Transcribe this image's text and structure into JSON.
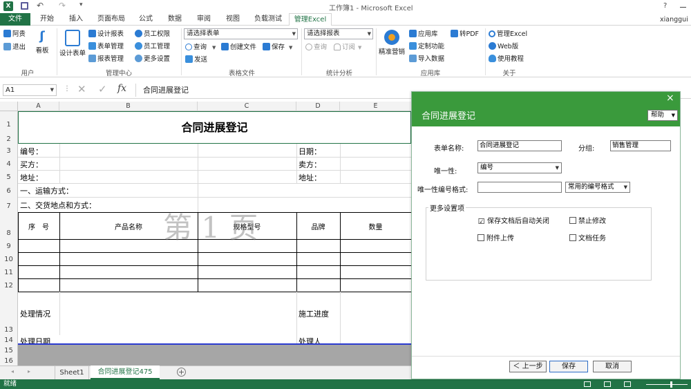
{
  "window": {
    "title": "工作簿1 - Microsoft Excel",
    "user": "xianggui",
    "help": "?"
  },
  "tabs": [
    "文件",
    "开始",
    "插入",
    "页面布局",
    "公式",
    "数据",
    "审阅",
    "视图",
    "负载测试",
    "管理Excel"
  ],
  "ribbon": {
    "user_group": {
      "label": "用户",
      "items": [
        "阿贵",
        "退出",
        "看板"
      ]
    },
    "mgmt_group": {
      "label": "管理中心",
      "big": "设计表单",
      "col1": [
        "设计报表",
        "表单管理",
        "报表管理"
      ],
      "col2": [
        "员工权限",
        "员工管理",
        "更多设置"
      ]
    },
    "form_group": {
      "label": "表格文件",
      "combo": "请选择表单",
      "items": [
        "查询",
        "创建文件",
        "保存",
        "发送"
      ]
    },
    "stat_group": {
      "label": "统计分析",
      "combo": "请选择报表",
      "items": [
        "查询",
        "订阅"
      ]
    },
    "app_group": {
      "label": "应用库",
      "big": "精准营销",
      "col1": [
        "应用库",
        "定制功能",
        "导入数据"
      ],
      "col2": [
        "转PDF"
      ]
    },
    "about_group": {
      "label": "关于",
      "items": [
        "管理Excel",
        "Web版",
        "使用教程"
      ]
    }
  },
  "formula": {
    "cell": "A1",
    "content": "合同进展登记",
    "fx": "fx"
  },
  "columns": [
    "A",
    "B",
    "C",
    "D",
    "E"
  ],
  "rows": [
    "1",
    "2",
    "3",
    "4",
    "5",
    "6",
    "7",
    "8",
    "9",
    "10",
    "11",
    "12",
    "13",
    "14",
    "15",
    "16"
  ],
  "sheet": {
    "title": "合同进展登记",
    "r3a": "编号：",
    "r3d": "日期：",
    "r4a": "买方：",
    "r4d": "卖方：",
    "r5a": "地址：",
    "r5d": "地址：",
    "r6a": "一、运输方式：",
    "r7a": "二、交货地点和方式：",
    "h_no": "序　号",
    "h_name": "产品名称",
    "h_spec": "规格型号",
    "h_brand": "品牌",
    "h_qty": "数量",
    "r13a": "处理情况",
    "r13d": "施工进度",
    "r14a": "处理日期",
    "r14d": "处理人",
    "watermark": "第 1 页"
  },
  "sheet_tabs": [
    "Sheet1",
    "合同进展登记475"
  ],
  "status": {
    "text": "就绪"
  },
  "panel": {
    "title": "合同进展登记",
    "help": "帮助",
    "close": "×",
    "form_name_label": "表单名称:",
    "form_name": "合同进展登记",
    "group_label": "分组:",
    "group": "销售管理",
    "unique_label": "唯一性:",
    "unique": "编号",
    "unique_fmt_label": "唯一性编号格式:",
    "unique_fmt": "",
    "fmt_dd": "常用的编号格式",
    "more_label": "更多设置项",
    "opt1": "保存文档后自动关闭",
    "opt1_checked": "☑",
    "opt2": "禁止修改",
    "opt3": "附件上传",
    "opt4": "文档任务",
    "prev": "＜ 上一步",
    "save": "保存",
    "cancel": "取消"
  }
}
